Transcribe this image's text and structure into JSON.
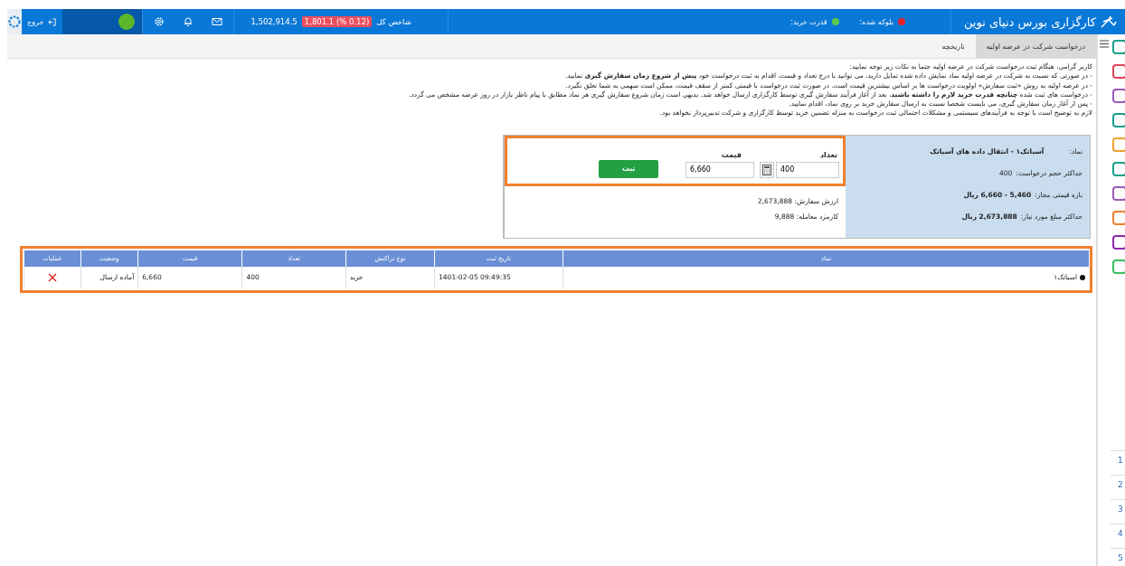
{
  "header": {
    "brand": "کارگزاری بورس دنیای نوین",
    "status": [
      {
        "label": "بلوکه شده:",
        "color": "#e8202a"
      },
      {
        "label": "قدرت خرید:",
        "color": "#5cc94a"
      }
    ],
    "index": {
      "label": "شاخص کل",
      "change": "1,801.1 (% 0.12)",
      "value": "1,502,914.5"
    },
    "logout": "خروج"
  },
  "tabs": [
    {
      "label": "درخواست شرکت در عرضه اولیه",
      "selected": true
    },
    {
      "label": "تاریخچه",
      "selected": false
    }
  ],
  "notice": [
    "کاربر گرامی، هنگام ثبت درخواست شرکت در عرضه اولیه حتما به نکات زیر توجه نمایید:",
    "- در صورتی که نسبت به شرکت در عرضه اولیه نماد نمایش داده شده تمایل دارید، می توانید با درج تعداد و قیمت، اقدام به ثبت درخواست خود **پیش از شروع زمان سفارش گیری** نمایید.",
    "- در عرضه اولیه به روش «ثبت سفارش» اولویت درخواست ها بر اساس بیشترین قیمت است. در صورت ثبت درخواست با قیمتی کمتر از سقف قیمت، ممکن است سهمی به شما تعلق نگیرد.",
    "- درخواست های ثبت شده **چنانچه قدرت خرید لازم را داشته باشید**، بعد از آغاز فرآیند سفارش گیری توسط کارگزاری ارسال خواهد شد. بدیهی است زمان شروع سفارش گیری هر نماد مطابق با پیام ناظر بازار در روز عرضه مشخص می گردد.",
    "- پس از آغاز زمان سفارش گیری، می بایست شخصا نسبت به ارسال سفارش خرید بر روی نماد، اقدام نمایید.",
    "لازم به توضیح است با توجه به فرآیندهای سیستمی و مشکلات احتمالی ثبت درخواست به منزله تضمین خرید توسط کارگزاری و شرکت تدبیرپرداز نخواهد بود."
  ],
  "symbol_info": [
    {
      "label": "نماد:",
      "value": "آسیاتک۱ - انتقال داده های آسیاتک"
    },
    {
      "label": "حداکثر حجم درخواست:",
      "value": "400"
    },
    {
      "label": "بازه قیمتی مجاز:",
      "value": "5,460 - 6,660 ریال"
    },
    {
      "label": "حداکثر مبلغ مورد نیاز:",
      "value": "2,673,888 ریال"
    }
  ],
  "order_form": {
    "quantity_label": "تعداد",
    "quantity": "400",
    "price_label": "قیمت",
    "price": "6,660",
    "submit": "ثبت",
    "order_value": "ارزش سفارش: 2,673,888",
    "fee": "کارمزد معامله: 9,888"
  },
  "table": {
    "columns": [
      "نماد",
      "تاریخ ثبت",
      "نوع تراکنش",
      "تعداد",
      "قیمت",
      "وضعیت",
      "عملیات"
    ],
    "rows": [
      {
        "symbol": "اسیاتک۱",
        "date": "1401-02-05 09:49:35",
        "type": "خرید",
        "quantity": "400",
        "price": "6,660",
        "status": "آماده ارسال"
      }
    ]
  },
  "pager": [
    "1",
    "2",
    "3",
    "4",
    "5"
  ]
}
